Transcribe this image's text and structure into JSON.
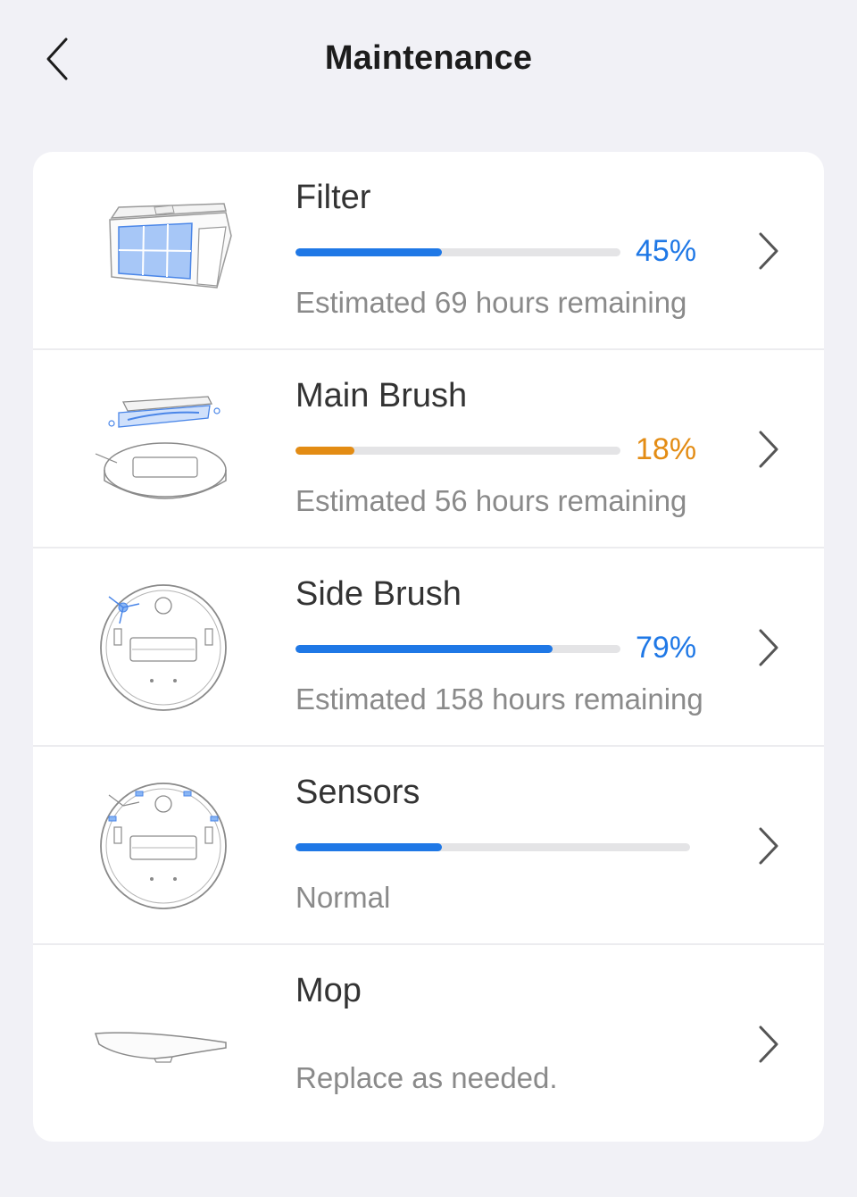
{
  "header": {
    "title": "Maintenance",
    "back_icon": "chevron-left-icon"
  },
  "colors": {
    "blue": "#1f78e6",
    "orange": "#e38c14",
    "track": "#e4e4e6"
  },
  "items": [
    {
      "name": "Filter",
      "percent": 45,
      "percent_label": "45%",
      "status": "Estimated 69 hours remaining",
      "color": "#1f78e6",
      "icon": "filter-icon"
    },
    {
      "name": "Main Brush",
      "percent": 18,
      "percent_label": "18%",
      "status": "Estimated 56 hours remaining",
      "color": "#e38c14",
      "icon": "main-brush-icon"
    },
    {
      "name": "Side Brush",
      "percent": 79,
      "percent_label": "79%",
      "status": "Estimated 158 hours remaining",
      "color": "#1f78e6",
      "icon": "side-brush-icon"
    },
    {
      "name": "Sensors",
      "percent": 37,
      "status": "Normal",
      "color": "#1f78e6",
      "icon": "sensors-icon"
    },
    {
      "name": "Mop",
      "status": "Replace as needed.",
      "icon": "mop-icon"
    }
  ]
}
